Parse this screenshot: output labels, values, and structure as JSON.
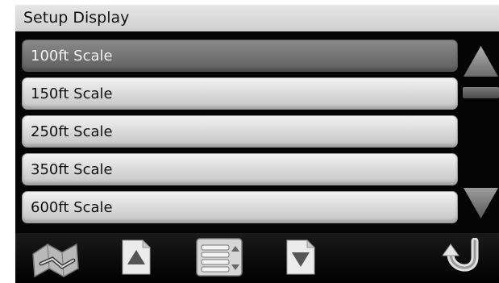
{
  "header": {
    "title": "Setup Display"
  },
  "scale_options": [
    {
      "label": "100ft Scale",
      "selected": true
    },
    {
      "label": "150ft Scale",
      "selected": false
    },
    {
      "label": "250ft Scale",
      "selected": false
    },
    {
      "label": "350ft Scale",
      "selected": false
    },
    {
      "label": "600ft Scale",
      "selected": false
    }
  ],
  "scrollbar": {
    "up_icon": "triangle-up-icon",
    "down_icon": "triangle-down-icon"
  },
  "toolbar": {
    "buttons": [
      "map-icon",
      "page-up-icon",
      "menu-list-icon",
      "page-down-icon",
      "back-arrow-icon"
    ]
  },
  "colors": {
    "background": "#050505",
    "title_bar": "#d9d9d9",
    "item_normal": "#d8d8d8",
    "item_selected": "#727272"
  }
}
